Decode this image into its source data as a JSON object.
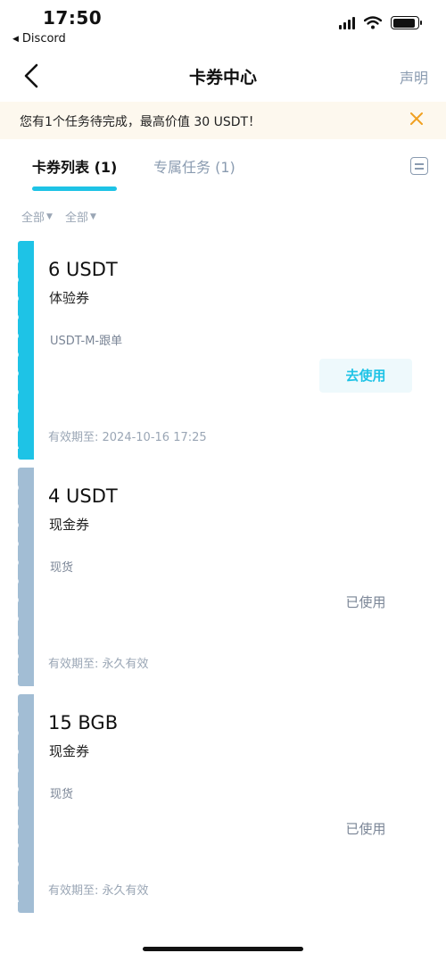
{
  "status_bar": {
    "time": "17:50",
    "back_app": "Discord",
    "icons": [
      "signal-icon",
      "wifi-icon",
      "battery-icon"
    ]
  },
  "header": {
    "title": "卡券中心",
    "right_link": "声明"
  },
  "banner": {
    "text": "您有1个任务待完成，最高价值 30 USDT！"
  },
  "tabs": [
    {
      "label": "卡券列表 (1)",
      "active": true
    },
    {
      "label": "专属任务 (1)",
      "active": false
    }
  ],
  "filters": [
    {
      "label": "全部"
    },
    {
      "label": "全部"
    }
  ],
  "coupons": [
    {
      "amount": "6 USDT",
      "type": "体验券",
      "scope": "USDT-M-跟单",
      "action": "去使用",
      "expiry": "有效期至: 2024-10-16 17:25",
      "status": "available"
    },
    {
      "amount": "4 USDT",
      "type": "现金券",
      "scope": "现货",
      "action": "已使用",
      "expiry": "有效期至: 永久有效",
      "status": "used"
    },
    {
      "amount": "15 BGB",
      "type": "现金券",
      "scope": "现货",
      "action": "已使用",
      "expiry": "有效期至: 永久有效",
      "status": "used"
    }
  ],
  "colors": {
    "accent": "#1ec3e6",
    "used_strip": "#a2bdd4",
    "banner_bg": "#fdf8ee",
    "close_icon": "#f0a020"
  }
}
